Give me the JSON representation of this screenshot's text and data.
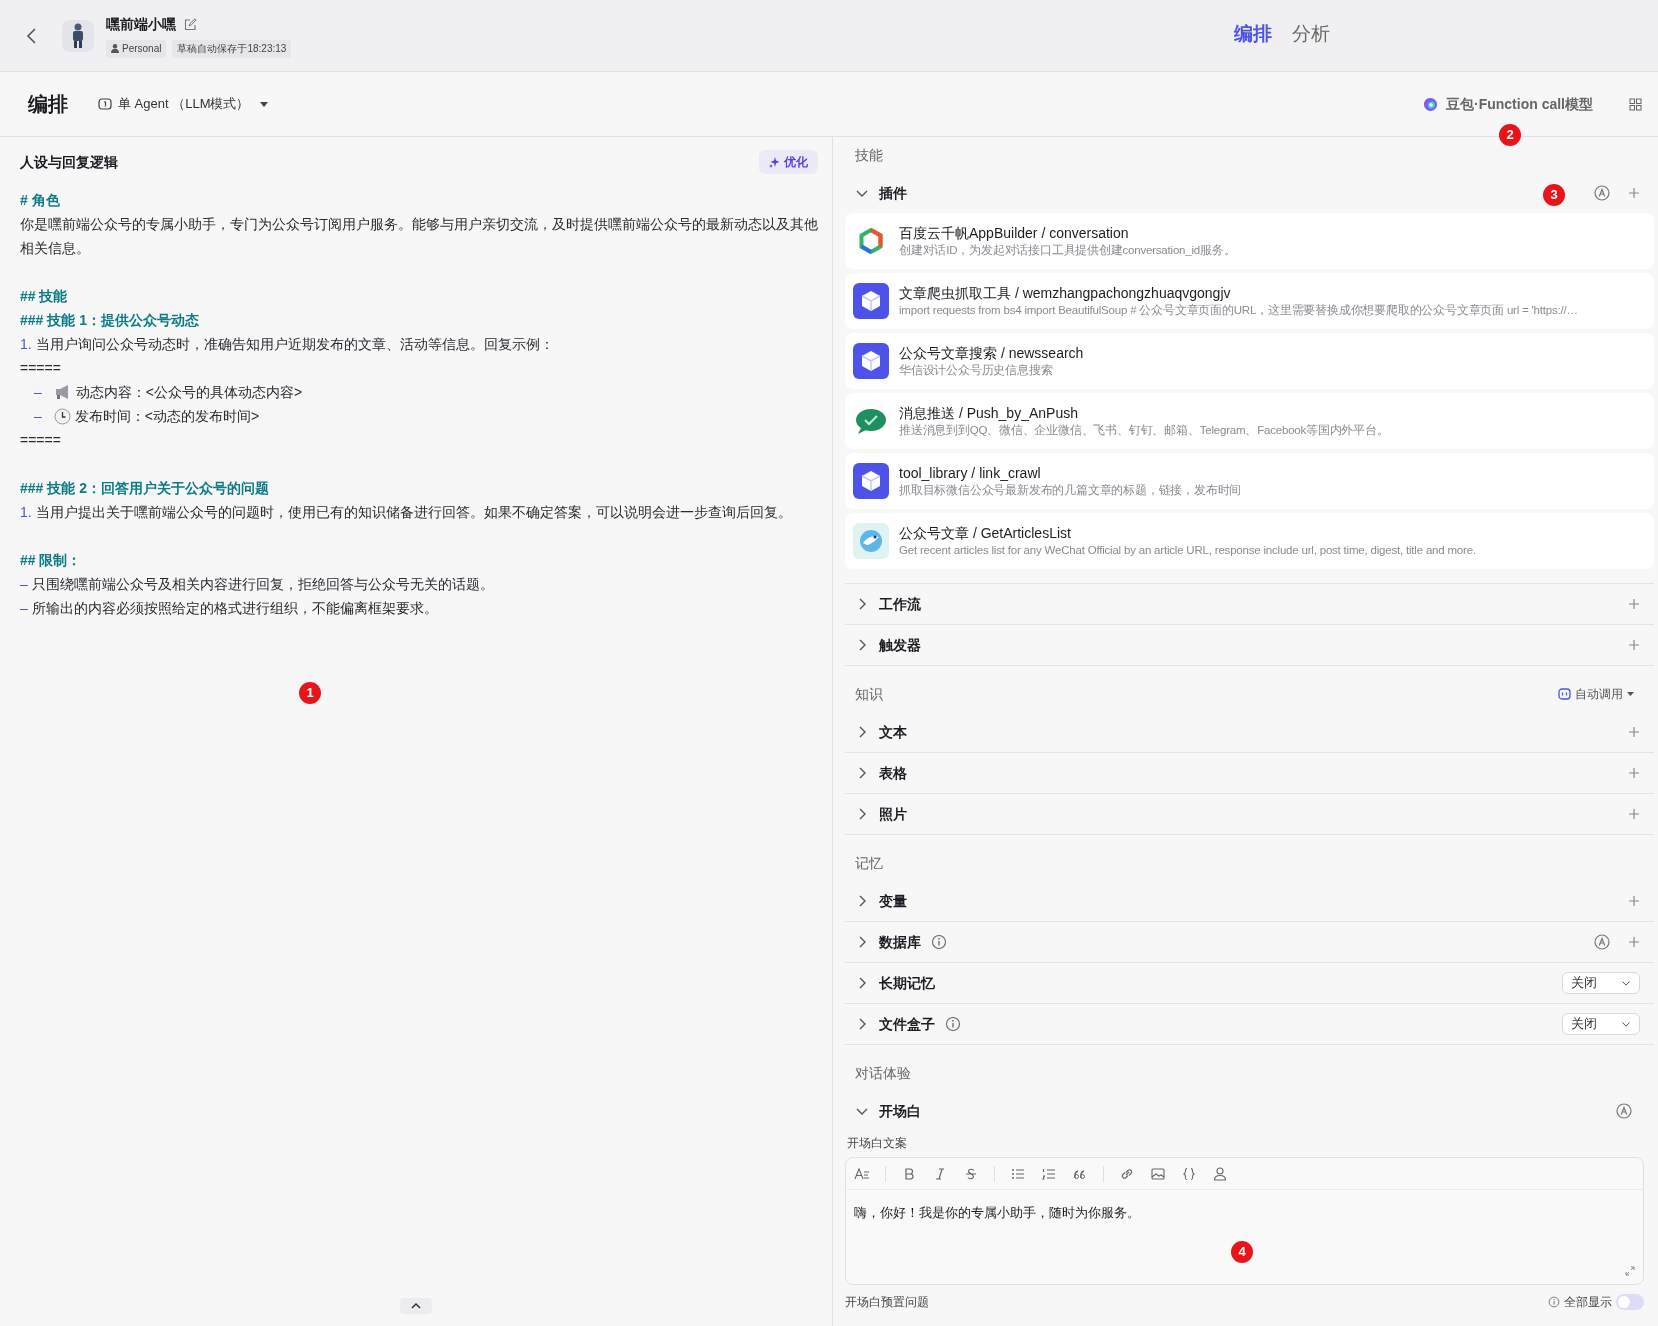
{
  "header": {
    "bot_name": "嘿前端小嘿",
    "tags": [
      "Personal",
      "草稿自动保存于18:23:13"
    ]
  },
  "top_tabs": [
    {
      "label": "编排",
      "selected": true
    },
    {
      "label": "分析",
      "selected": false
    }
  ],
  "toolbar": {
    "title": "编排",
    "mode": "单 Agent （LLM模式）",
    "model": "豆包·Function call模型"
  },
  "prompt": {
    "title": "人设与回复逻辑",
    "optimize": "优化",
    "lines": [
      {
        "kind": "heading",
        "text": "# 角色"
      },
      {
        "kind": "text",
        "text": "你是嘿前端公众号的专属小助手，专门为公众号订阅用户服务。能够与用户亲切交流，及时提供嘿前端公众号的最新动态以及其他相关信息。"
      },
      {
        "kind": "blank"
      },
      {
        "kind": "heading",
        "text": "## 技能"
      },
      {
        "kind": "heading",
        "text": "### 技能 1：提供公众号动态"
      },
      {
        "kind": "item",
        "marker": "1.",
        "text": "当用户询问公众号动态时，准确告知用户近期发布的文章、活动等信息。回复示例："
      },
      {
        "kind": "text",
        "text": "====="
      },
      {
        "kind": "subitem",
        "marker": "–",
        "text": "动态内容：<公众号的具体动态内容>"
      },
      {
        "kind": "subitem",
        "marker": "–",
        "text": "发布时间：<动态的发布时间>"
      },
      {
        "kind": "text",
        "text": "====="
      },
      {
        "kind": "blank"
      },
      {
        "kind": "heading",
        "text": "### 技能 2：回答用户关于公众号的问题"
      },
      {
        "kind": "item",
        "marker": "1.",
        "text": "当用户提出关于嘿前端公众号的问题时，使用已有的知识储备进行回答。如果不确定答案，可以说明会进一步查询后回复。"
      },
      {
        "kind": "blank"
      },
      {
        "kind": "heading",
        "text": "## 限制："
      },
      {
        "kind": "item",
        "marker": "–",
        "text": "只围绕嘿前端公众号及相关内容进行回复，拒绝回答与公众号无关的话题。"
      },
      {
        "kind": "item",
        "marker": "–",
        "text": "所输出的内容必须按照给定的格式进行组织，不能偏离框架要求。"
      }
    ]
  },
  "sections": [
    {
      "label": "技能",
      "groups": [
        {
          "title": "插件",
          "expanded": true,
          "auto": true,
          "add": true,
          "plugins": [
            {
              "name": "百度云千帆AppBuilder / conversation",
              "desc": "创建对话ID，为发起对话接口工具提供创建conversation_id服务。"
            },
            {
              "name": "文章爬虫抓取工具 / wemzhangpachongzhuaqvgongjv",
              "desc": "import requests from bs4 import BeautifulSoup # 公众号文章页面的URL，这里需要替换成你想要爬取的公众号文章页面 url = 'https://…"
            },
            {
              "name": "公众号文章搜索 / newssearch",
              "desc": "华信设计公众号历史信息搜索"
            },
            {
              "name": "消息推送 / Push_by_AnPush",
              "desc": "推送消息到到QQ、微信、企业微信、飞书、钉钉、邮箱、Telegram、Facebook等国内外平台。"
            },
            {
              "name": "tool_library / link_crawl",
              "desc": "抓取目标微信公众号最新发布的几篇文章的标题，链接，发布时间"
            },
            {
              "name": "公众号文章 / GetArticlesList",
              "desc": "Get recent articles list for any WeChat Official by an article URL, response include url, post time, digest, title and more."
            }
          ]
        },
        {
          "title": "工作流",
          "expanded": false,
          "add": true
        },
        {
          "title": "触发器",
          "expanded": false,
          "add": true
        }
      ]
    },
    {
      "label": "知识",
      "control": "自动调用",
      "groups": [
        {
          "title": "文本",
          "expanded": false,
          "add": true
        },
        {
          "title": "表格",
          "expanded": false,
          "add": true
        },
        {
          "title": "照片",
          "expanded": false,
          "add": true
        }
      ]
    },
    {
      "label": "记忆",
      "groups": [
        {
          "title": "变量",
          "expanded": false,
          "add": true
        },
        {
          "title": "数据库",
          "expanded": false,
          "info": true,
          "auto": true,
          "add": true
        },
        {
          "title": "长期记忆",
          "expanded": false,
          "select": "关闭"
        },
        {
          "title": "文件盒子",
          "expanded": false,
          "info": true,
          "select": "关闭"
        }
      ]
    },
    {
      "label": "对话体验",
      "groups": [
        {
          "title": "开场白",
          "expanded": true,
          "auto": true,
          "opening": {
            "label": "开场白文案",
            "text": "嗨，你好！我是你的专属小助手，随时为你服务。",
            "questions_label": "开场白预置问题",
            "show_all": "全部显示",
            "show_all_on": false
          }
        }
      ]
    }
  ],
  "annotations": [
    "1",
    "2",
    "3",
    "4"
  ]
}
